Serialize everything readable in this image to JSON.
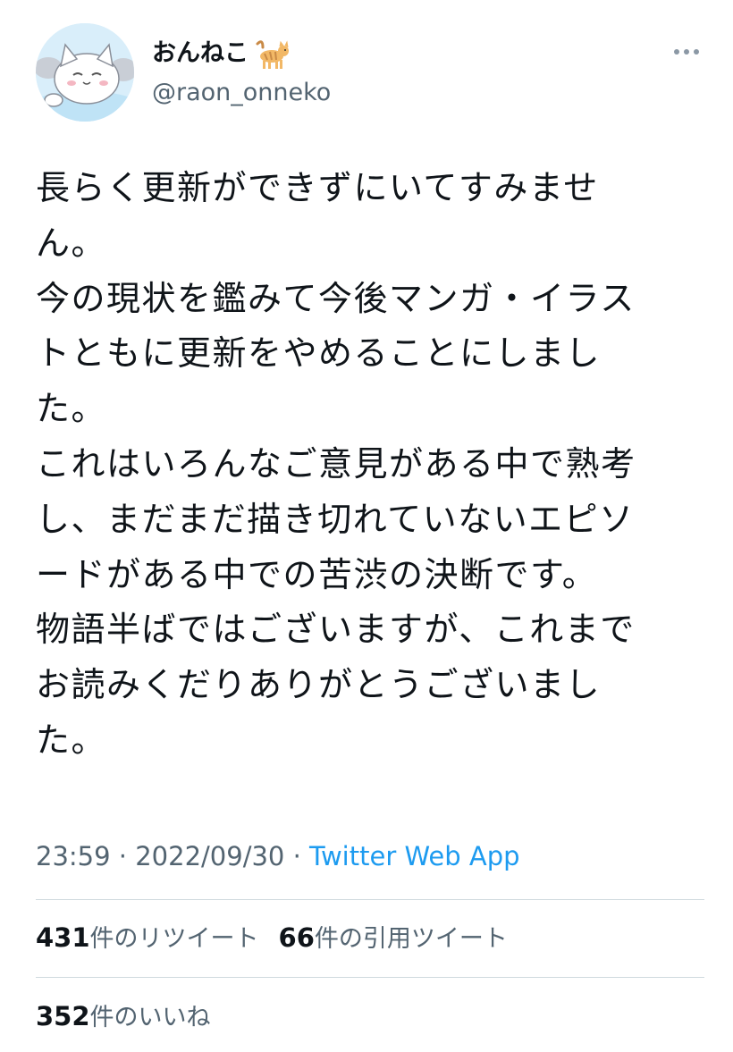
{
  "tweet": {
    "author": {
      "display_name": "おんねこ",
      "handle": "@raon_onneko"
    },
    "text_lines": [
      "長らく更新ができずにいてすみませ",
      "ん。",
      "今の現状を鑑みて今後マンガ・イラス",
      "トともに更新をやめることにしまし",
      "た。",
      "これはいろんなご意見がある中で熟考",
      "し、まだまだ描き切れていないエピソ",
      "ードがある中での苦渋の決断です。",
      "物語半ばではございますが、これまで",
      "お読みくだりありがとうございまし",
      "た。"
    ],
    "time": "23:59",
    "separator": " · ",
    "date": "2022/09/30",
    "source": "Twitter Web App"
  },
  "stats": {
    "retweets_count": "431",
    "retweets_label": "件のリツイート",
    "quotes_count": "66",
    "quotes_label": "件の引用ツイート",
    "likes_count": "352",
    "likes_label": "件のいいね"
  },
  "icons": {
    "avatar": "cat-avatar",
    "emoji": "cat-emoji",
    "more": "more-icon"
  },
  "colors": {
    "text": "#0f1419",
    "secondary": "#536471",
    "link": "#1d9bf0",
    "divider": "#cfd9de"
  }
}
